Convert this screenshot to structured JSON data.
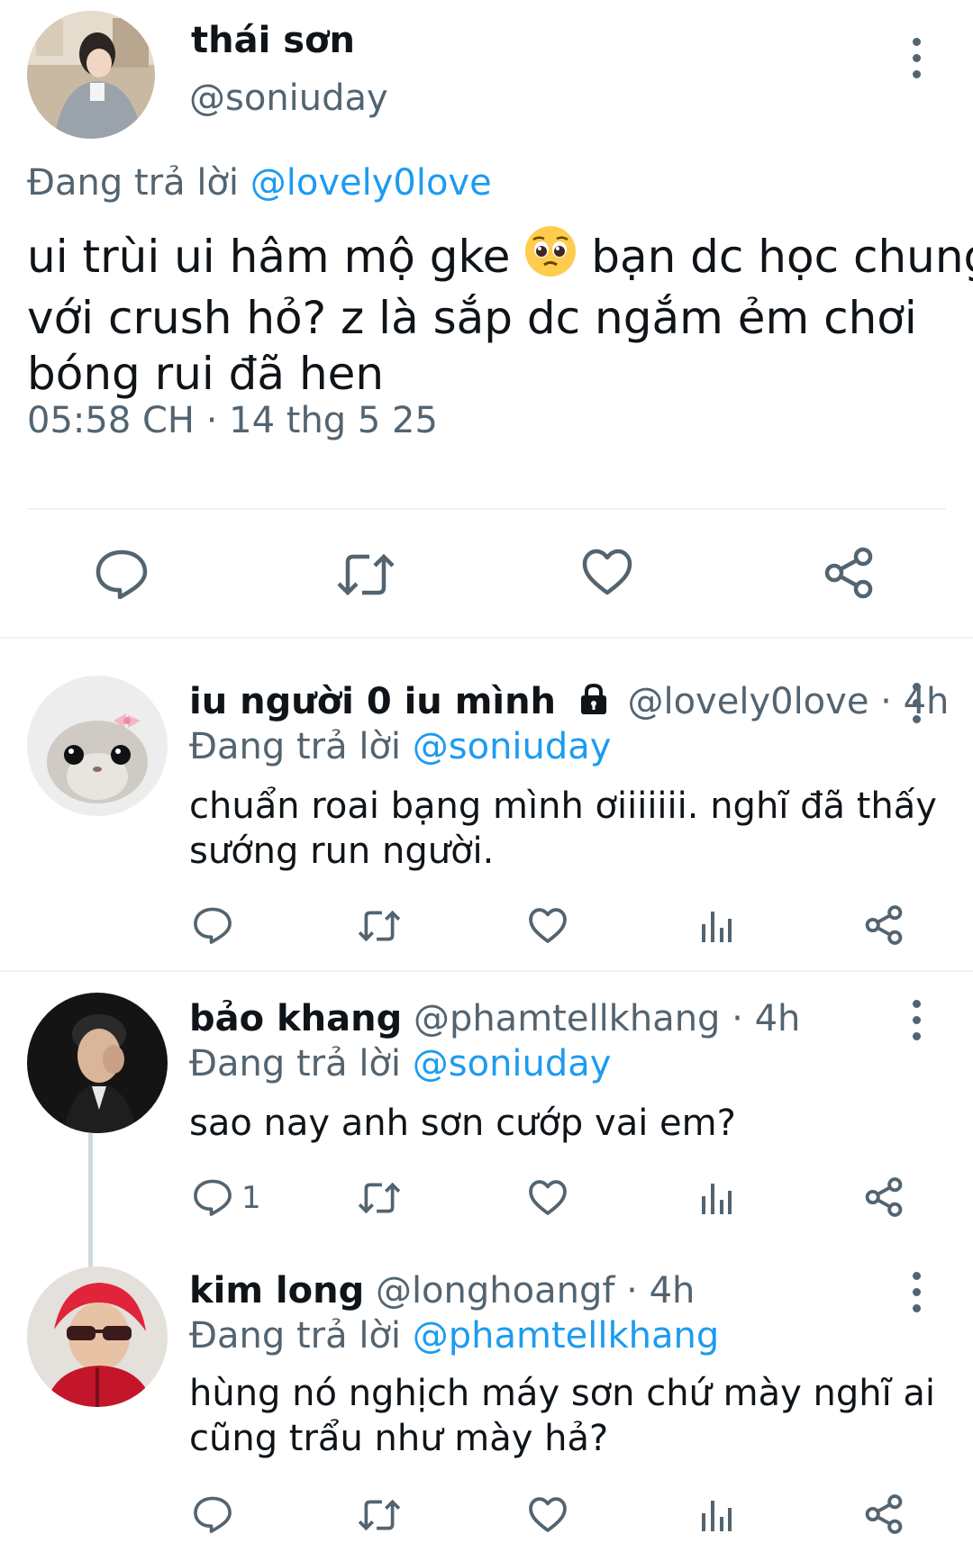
{
  "main_tweet": {
    "author_name": "thái sơn",
    "author_handle": "@soniuday",
    "reply_prefix": "Đang trả lời",
    "reply_to": "@lovely0love",
    "text_line1_a": "ui trùi ui hâm mộ gke",
    "emoji": "🥺",
    "text_line1_b": "bạn dc học chung",
    "text_line2": "với crush hỏ? z là sắp dc ngắm ẻm chơi",
    "text_line3": "bóng rui đã hen",
    "timestamp": "05:58 CH · 14 thg 5 25"
  },
  "replies": [
    {
      "name": "iu người 0 iu mình",
      "handle": "@lovely0love",
      "time": "· 4h",
      "protected": true,
      "reply_prefix": "Đang trả lời",
      "reply_to": "@soniuday",
      "text_lines": [
        "chuẩn roai bạng mình ơiiiiiii. nghĩ đã thấy",
        "sướng run người."
      ],
      "reply_count": ""
    },
    {
      "name": "bảo khang",
      "handle": "@phamtellkhang",
      "time": "· 4h",
      "protected": false,
      "reply_prefix": "Đang trả lời",
      "reply_to": "@soniuday",
      "text_lines": [
        "sao nay anh sơn cướp vai em?"
      ],
      "reply_count": "1"
    },
    {
      "name": "kim long",
      "handle": "@longhoangf",
      "time": "· 4h",
      "protected": false,
      "reply_prefix": "Đang trả lời",
      "reply_to": "@phamtellkhang",
      "text_lines": [
        "hùng nó nghịch máy sơn chứ mày nghĩ ai",
        "cũng trẩu như mày hả?"
      ],
      "reply_count": ""
    }
  ],
  "icons": [
    "reply-icon",
    "retweet-icon",
    "like-icon",
    "views-icon",
    "share-icon",
    "more-icon",
    "lock-icon"
  ],
  "colors": {
    "text": "#0f1419",
    "secondary": "#536471",
    "link": "#1d9bf0",
    "divider": "#eff3f4"
  }
}
